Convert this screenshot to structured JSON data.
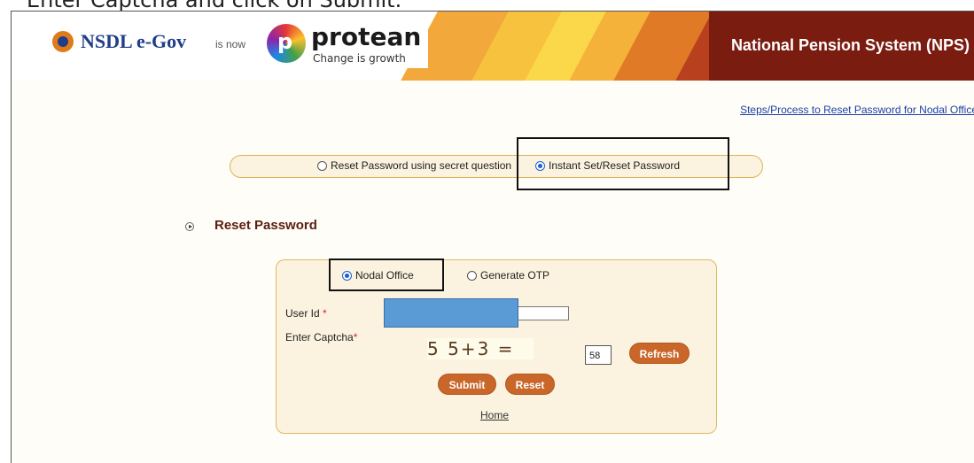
{
  "caption": "Enter Captcha and click on Submit.",
  "header": {
    "nsdl_brand": "NSDL e-Gov",
    "is_now": "is now",
    "protean_brand": "protean",
    "protean_tagline": "Change is growth",
    "title": "National Pension System (NPS)"
  },
  "steps_link": "Steps/Process to Reset Password for Nodal Office",
  "reset_mode": {
    "options": [
      "Reset Password using secret question",
      "Instant Set/Reset Password"
    ],
    "selected": "Instant Set/Reset Password"
  },
  "section_title": "Reset Password",
  "form": {
    "type_options": [
      "Nodal Office",
      "Generate OTP"
    ],
    "type_selected": "Nodal Office",
    "user_id_label": "User Id",
    "required_mark": "*",
    "captcha_label": "Enter Captcha",
    "captcha_text": "5 5+3 =",
    "captcha_value": "58",
    "refresh_label": "Refresh",
    "submit_label": "Submit",
    "reset_label": "Reset",
    "home_label": "Home"
  },
  "colors": {
    "header_dark": "#7a1c10",
    "button": "#c9662a",
    "panel_bg": "#fbf3df",
    "panel_border": "#e0b860",
    "redaction": "#5b9bd5"
  }
}
